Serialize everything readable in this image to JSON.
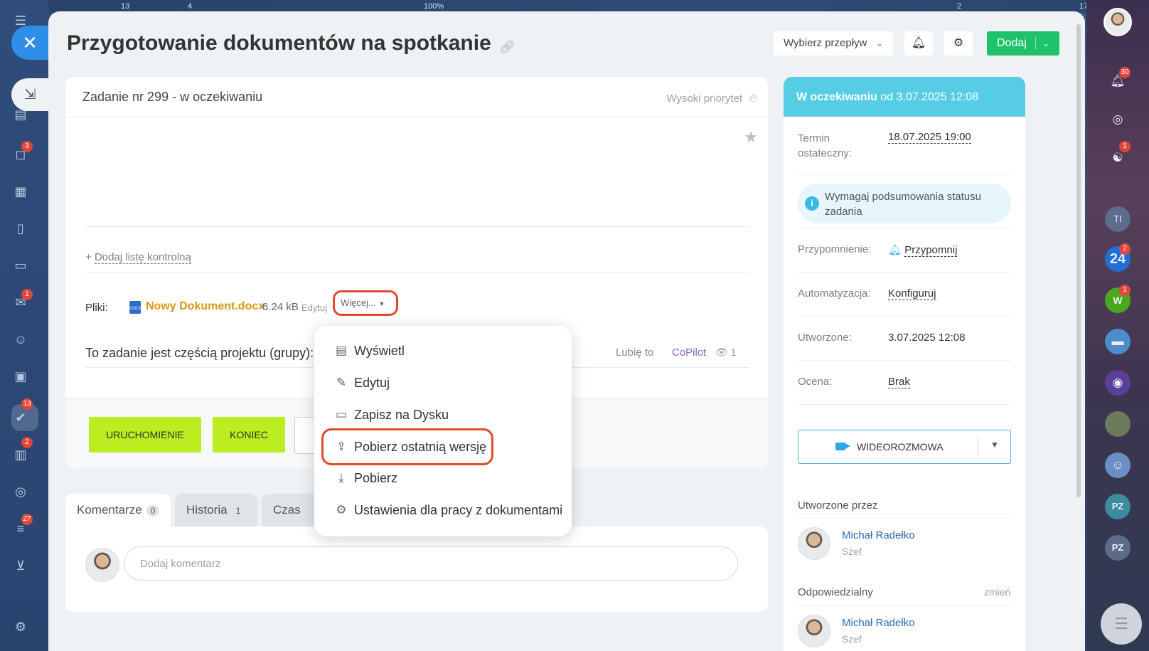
{
  "background": {
    "top_badges": [
      "13",
      "4",
      "2",
      "17"
    ],
    "zoom": "100%"
  },
  "left_sidebar": {
    "badges": [
      "3",
      "1",
      "13",
      "2",
      "27"
    ]
  },
  "header": {
    "title": "Przygotowanie dokumentów na spotkanie",
    "flow_select": "Wybierz przepływ",
    "add_label": "Dodaj"
  },
  "task": {
    "subtitle": "Zadanie nr 299 - w oczekiwaniu",
    "priority": "Wysoki priorytet",
    "add_checklist": "Dodaj listę kontrolną",
    "files_label": "Pliki:",
    "file": {
      "name": "Nowy Dokument.docx",
      "size": "6.24 kB",
      "edit": "Edytuj",
      "more": "Więcej...",
      "icon_text": "DOCX"
    },
    "project_line": "To zadanie jest częścią projektu (grupy):",
    "like": "Lubię to",
    "copilot": "CoPilot",
    "views": "1",
    "buttons": {
      "start": "URUCHOMIENIE",
      "finish": "KONIEC"
    }
  },
  "tabs": [
    {
      "label": "Komentarze",
      "count": "0"
    },
    {
      "label": "Historia",
      "count": "1"
    },
    {
      "label": "Czas"
    }
  ],
  "comment": {
    "placeholder": "Dodaj komentarz"
  },
  "menu": {
    "items": [
      {
        "label": "Wyświetl",
        "icon": "document-icon"
      },
      {
        "label": "Edytuj",
        "icon": "edit-icon"
      },
      {
        "label": "Zapisz na Dysku",
        "icon": "drive-icon"
      },
      {
        "label": "Pobierz ostatnią wersję",
        "icon": "upload-icon"
      },
      {
        "label": "Pobierz",
        "icon": "download-icon"
      },
      {
        "label": "Ustawienia dla pracy z dokumentami",
        "icon": "gear-icon"
      }
    ]
  },
  "status": {
    "state": "W oczekiwaniu",
    "since": "od 3.07.2025 12:08",
    "color": "#56cde4"
  },
  "side": {
    "deadline_label": "Termin ostateczny:",
    "deadline": "18.07.2025 19:00",
    "info": "Wymagaj podsumowania statusu zadania",
    "reminder_label": "Przypomnienie:",
    "reminder": "Przypomnij",
    "automation_label": "Automatyzacja:",
    "automation": "Konfiguruj",
    "created_label": "Utworzone:",
    "created": "3.07.2025 12:08",
    "rating_label": "Ocena:",
    "rating": "Brak",
    "video": "WIDEOROZMOWA",
    "created_by_label": "Utworzone przez",
    "responsible_label": "Odpowiedzialny",
    "change": "zmień",
    "creator": {
      "name": "Michał Radełko",
      "role": "Szef"
    },
    "responsible": {
      "name": "Michał Radełko",
      "role": "Szef"
    }
  },
  "right_bar": {
    "notifications": "30",
    "chat_badge": "1",
    "ti": "TI",
    "b24": "24",
    "b24_badge": "2",
    "w": "W",
    "w_badge": "1",
    "pz1": "PZ",
    "pz2": "PZ"
  },
  "colors": {
    "accent_green": "#1ec26b",
    "lime": "#bbed21",
    "highlight": "#e04b2c",
    "link": "#2d6bb0"
  }
}
